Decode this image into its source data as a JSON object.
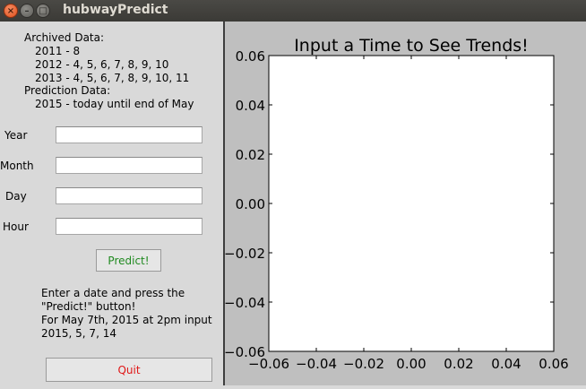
{
  "window": {
    "title": "hubwayPredict",
    "close_glyph": "×",
    "minimize_glyph": "–",
    "maximize_glyph": "□"
  },
  "info": {
    "archived_heading": "Archived Data:",
    "archived_lines": [
      "2011 - 8",
      "2012 - 4, 5, 6, 7, 8, 9, 10",
      "2013 - 4, 5, 6, 7, 8, 9, 10, 11"
    ],
    "prediction_heading": "Prediction Data:",
    "prediction_lines": [
      "2015 - today until end of May"
    ]
  },
  "form": {
    "year_label": "Year",
    "year_value": "",
    "month_label": "Month",
    "month_value": "",
    "day_label": "Day",
    "day_value": "",
    "hour_label": "Hour",
    "hour_value": "",
    "predict_label": "Predict!"
  },
  "instructions": {
    "line1": "Enter a date and press the",
    "line2": "\"Predict!\" button!",
    "line3": "For May 7th, 2015 at 2pm input",
    "line4": "2015, 5, 7, 14"
  },
  "quit_label": "Quit",
  "colors": {
    "predict_text": "#208a20",
    "quit_text": "#e01818",
    "plot_bg": "#bfbfbf"
  },
  "chart_data": {
    "type": "line",
    "title": "Input a Time to See Trends!",
    "xlim": [
      -0.06,
      0.06
    ],
    "ylim": [
      -0.06,
      0.06
    ],
    "xticks": [
      "−0.06",
      "−0.04",
      "−0.02",
      "0.00",
      "0.02",
      "0.04",
      "0.06"
    ],
    "yticks": [
      "0.06",
      "0.04",
      "0.02",
      "0.00",
      "−0.02",
      "−0.04",
      "−0.06"
    ],
    "series": [],
    "grid": false
  }
}
